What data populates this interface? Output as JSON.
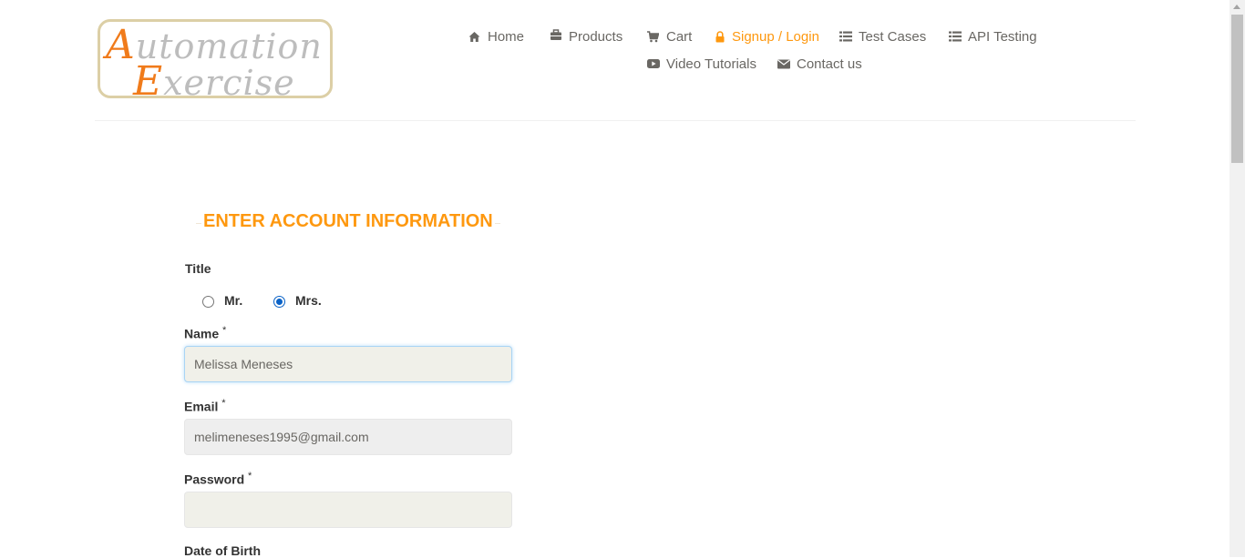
{
  "logo": {
    "line1_cap": "A",
    "line1_rest": "utomation",
    "line2_cap": "E",
    "line2_rest": "xercise"
  },
  "nav": {
    "home": "Home",
    "products": "Products",
    "cart": "Cart",
    "signup": "Signup / Login",
    "test_cases": "Test Cases",
    "api_testing": "API Testing",
    "video_tutorials": "Video Tutorials",
    "contact_us": "Contact us"
  },
  "form": {
    "heading": "ENTER ACCOUNT INFORMATION",
    "title_label": "Title",
    "title_options": {
      "mr": "Mr.",
      "mrs": "Mrs."
    },
    "title_selected": "Mrs.",
    "name_label": "Name",
    "name_value": "Melissa Meneses",
    "email_label": "Email",
    "email_value": "melimeneses1995@gmail.com",
    "password_label": "Password",
    "password_value": "",
    "required_mark": "*",
    "dob_label": "Date of Birth"
  },
  "colors": {
    "accent": "#fe980f",
    "text": "#696763",
    "radio_selected": "#0a62c7"
  }
}
